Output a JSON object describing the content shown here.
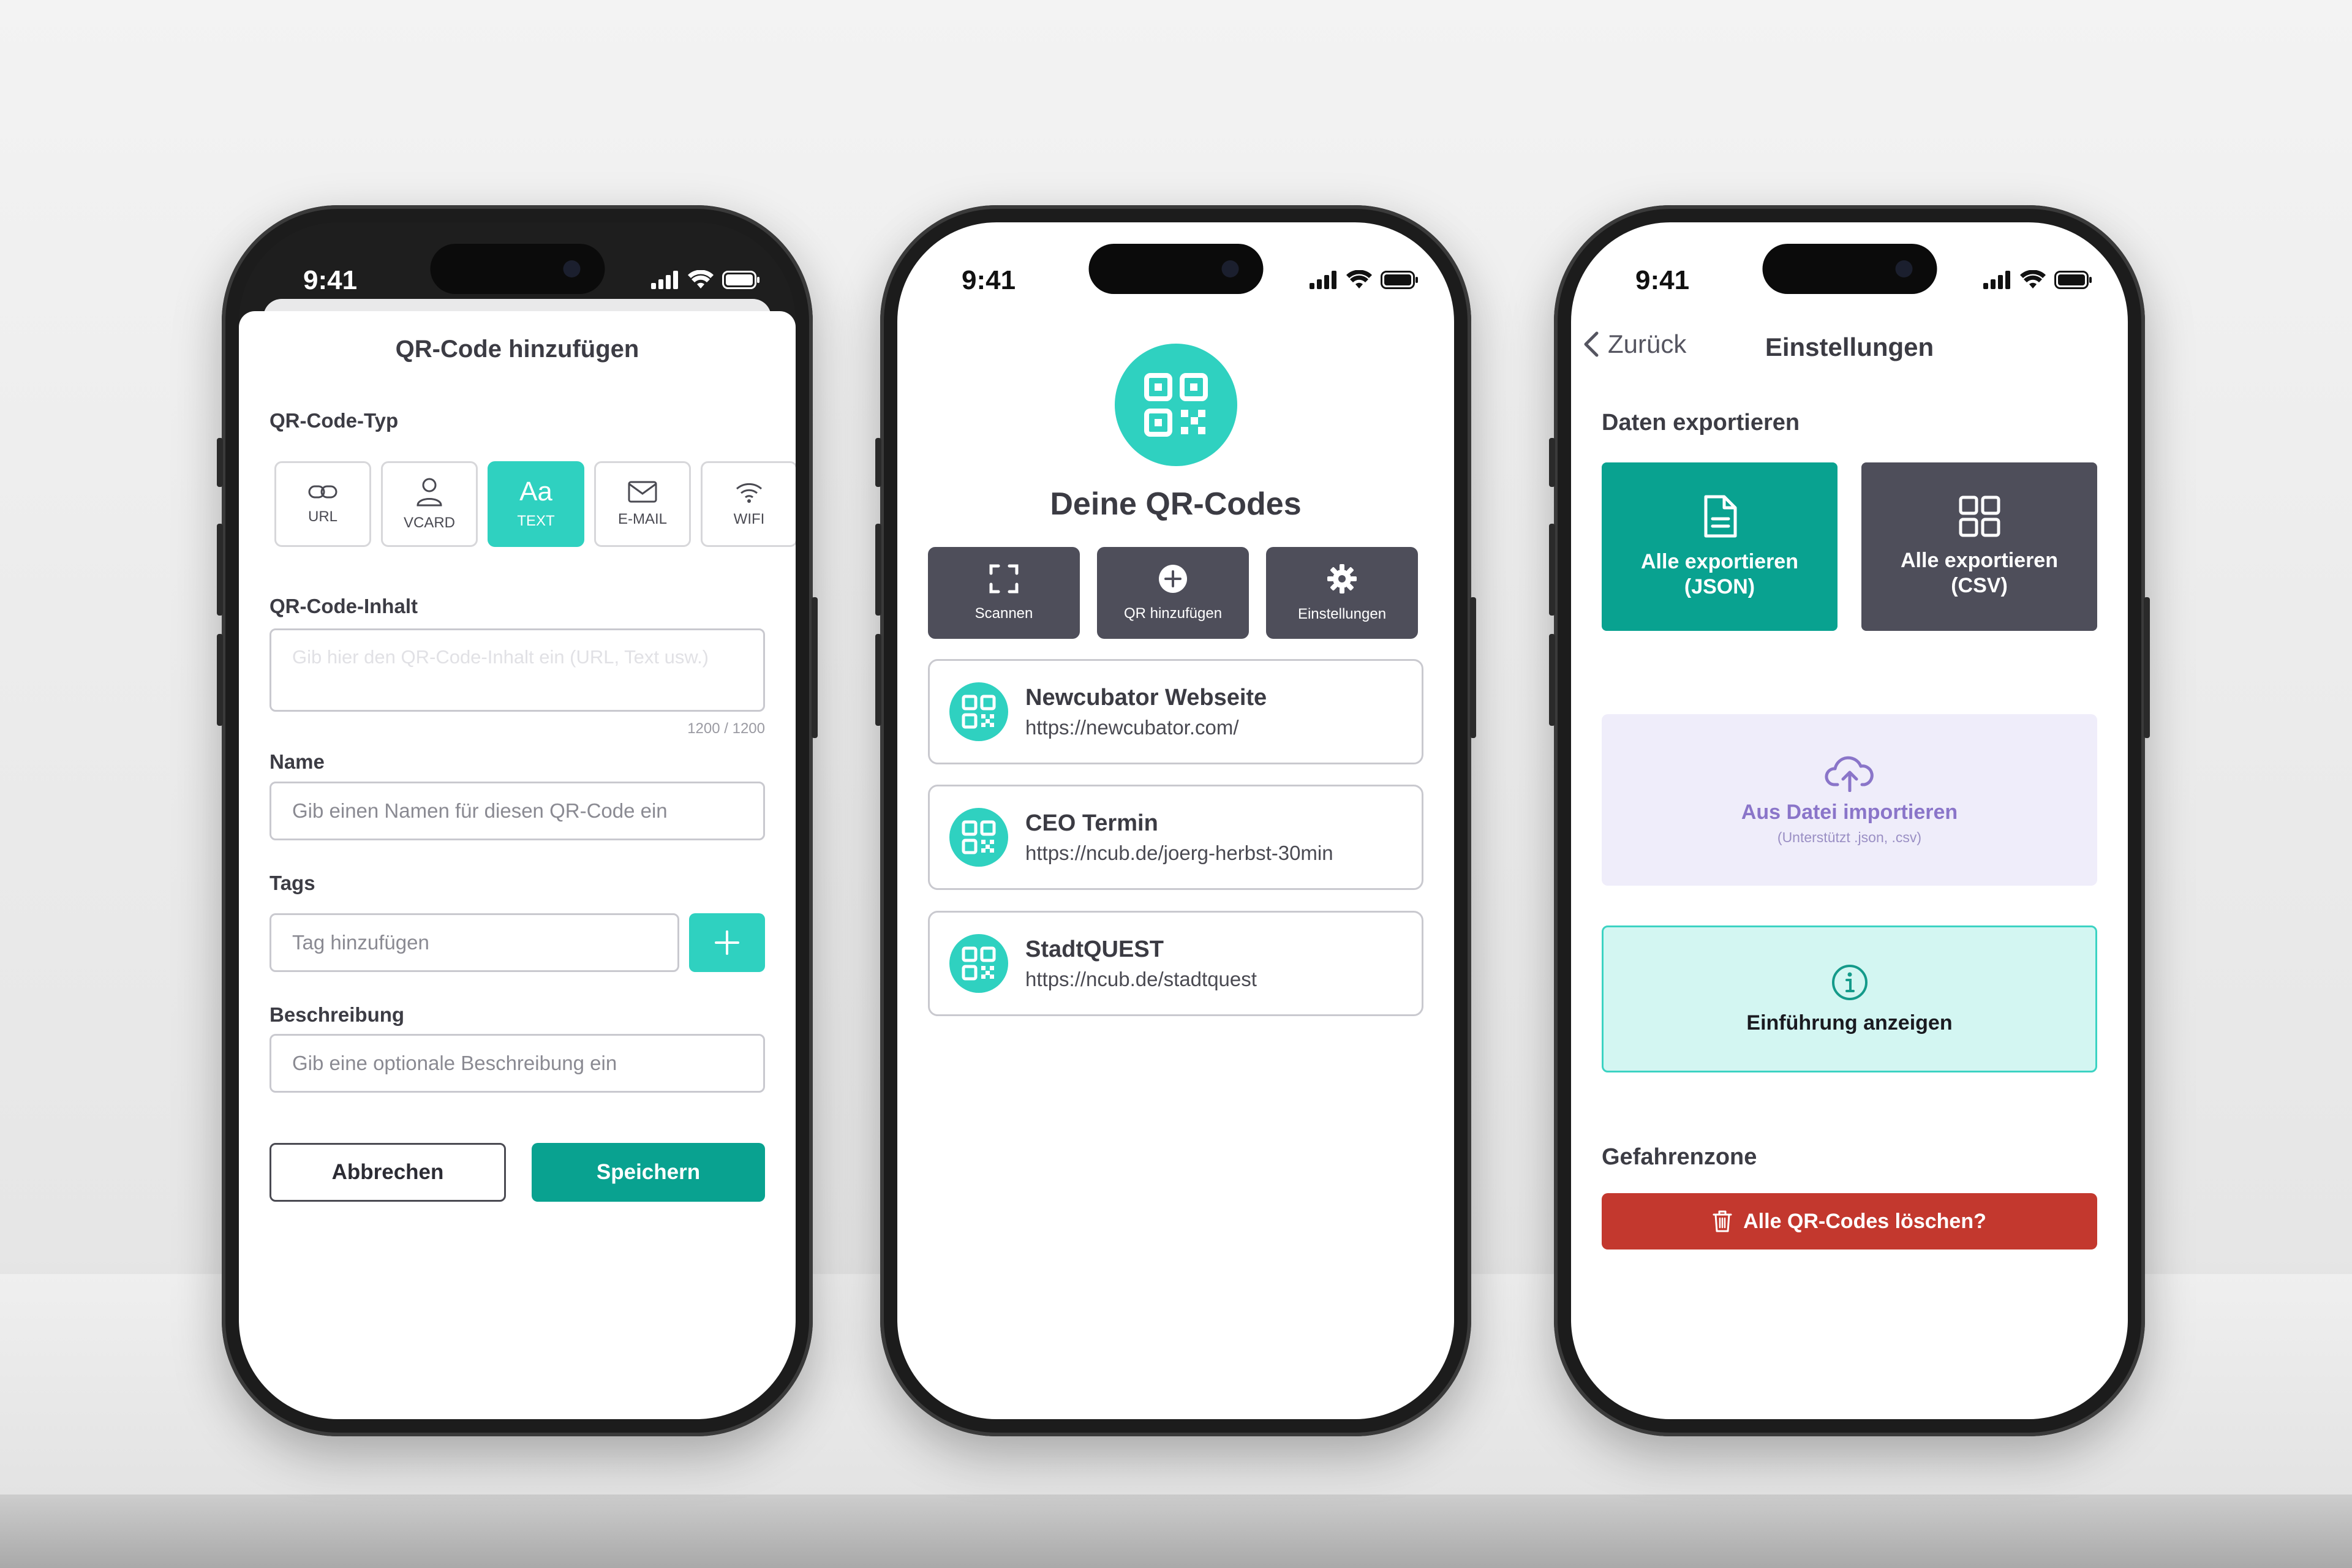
{
  "status": {
    "time": "9:41"
  },
  "add_screen": {
    "title": "QR-Code hinzufügen",
    "type_label": "QR-Code-Typ",
    "types": [
      {
        "label": "URL",
        "icon": "link-icon",
        "active": false
      },
      {
        "label": "VCARD",
        "icon": "person-icon",
        "active": false
      },
      {
        "label": "TEXT",
        "icon": "text-icon",
        "glyph": "Aa",
        "active": true
      },
      {
        "label": "E-MAIL",
        "icon": "mail-icon",
        "active": false
      },
      {
        "label": "WIFI",
        "icon": "wifi-icon",
        "active": false
      }
    ],
    "content_label": "QR-Code-Inhalt",
    "content_placeholder": "Gib hier den QR-Code-Inhalt ein (URL, Text usw.)",
    "content_counter": "1200 / 1200",
    "name_label": "Name",
    "name_placeholder": "Gib einen Namen für diesen QR-Code ein",
    "tags_label": "Tags",
    "tags_placeholder": "Tag hinzufügen",
    "description_label": "Beschreibung",
    "description_placeholder": "Gib eine optionale Beschreibung ein",
    "cancel": "Abbrechen",
    "save": "Speichern"
  },
  "list_screen": {
    "title": "Deine QR-Codes",
    "actions": [
      {
        "label": "Scannen",
        "icon": "scan-icon"
      },
      {
        "label": "QR hinzufügen",
        "icon": "plus-circle-icon"
      },
      {
        "label": "Einstellungen",
        "icon": "gear-icon"
      }
    ],
    "items": [
      {
        "name": "Newcubator Webseite",
        "url": "https://newcubator.com/"
      },
      {
        "name": "CEO Termin",
        "url": "https://ncub.de/joerg-herbst-30min"
      },
      {
        "name": "StadtQUEST",
        "url": "https://ncub.de/stadtquest"
      }
    ]
  },
  "settings_screen": {
    "back": "Zurück",
    "title": "Einstellungen",
    "export_section": "Daten exportieren",
    "export_json": "Alle exportieren (JSON)",
    "export_csv": "Alle exportieren (CSV)",
    "import_label": "Aus Datei importieren",
    "import_sub": "(Unterstützt .json, .csv)",
    "intro": "Einführung anzeigen",
    "danger_section": "Gefahrenzone",
    "delete_all": "Alle QR-Codes löschen?"
  },
  "colors": {
    "teal": "#2fd1c0",
    "teal_dark": "#09a290",
    "slate": "#4e4e5a",
    "danger": "#c3382e",
    "import_bg": "#efedfa",
    "intro_bg": "#d3f6f2"
  }
}
